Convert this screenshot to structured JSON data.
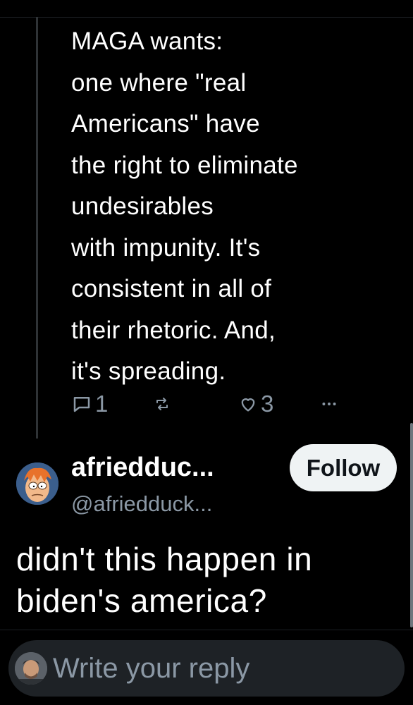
{
  "post": {
    "text": "MAGA wants:\none where \"real\nAmericans\" have\nthe right to eliminate\nundesirables\nwith impunity. It's\nconsistent in all of\ntheir rhetoric. And,\nit's spreading.",
    "actions": {
      "reply_count": "1",
      "like_count": "3"
    }
  },
  "reply": {
    "display_name": "afriedduc...",
    "handle": "@afriedduck...",
    "follow_label": "Follow",
    "text": "didn't this happen in biden's america?"
  },
  "composer": {
    "placeholder": "Write your reply"
  },
  "icons": {
    "reply": "reply-icon",
    "repost": "repost-icon",
    "like": "heart-icon",
    "more": "more-options-icon"
  },
  "colors": {
    "background": "#000000",
    "text": "#ffffff",
    "muted": "#8b98a5",
    "follow_button_bg": "#eff3f4",
    "composer_bg": "#1e2226"
  }
}
